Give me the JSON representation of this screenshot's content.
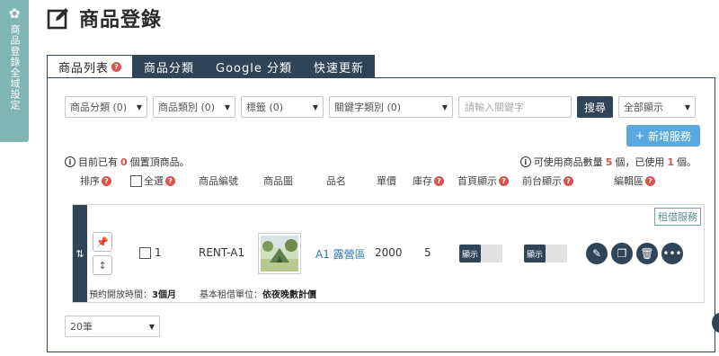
{
  "side_tab": {
    "label": "商品登錄全域設定",
    "icon": "gear-icon"
  },
  "page": {
    "title": "商品登錄",
    "icon": "edit-square-icon"
  },
  "tabs": [
    {
      "label": "商品列表",
      "active": true
    },
    {
      "label": "商品分類",
      "active": false
    },
    {
      "label": "Google 分類",
      "active": false
    },
    {
      "label": "快速更新",
      "active": false
    }
  ],
  "filters": {
    "product_category": "商品分類 (0)",
    "product_type": "商品類別 (0)",
    "tag": "標籤 (0)",
    "keyword_type": "關鍵字類別 (0)",
    "keyword_placeholder": "請輸入關鍵字",
    "search_button": "搜尋",
    "display": "全部顯示"
  },
  "add_button": "新增服務",
  "info": {
    "pinned_prefix": "目前已有",
    "pinned_count": "0",
    "pinned_suffix": "個置頂商品。",
    "quota_prefix": "可使用商品數量",
    "quota_total": "5",
    "quota_mid": "個，已使用",
    "quota_used": "1",
    "quota_suffix": "個。"
  },
  "columns": {
    "sort": "排序",
    "select_all": "全選",
    "code": "商品編號",
    "image": "商品圖",
    "name": "品名",
    "price": "單價",
    "stock": "庫存",
    "home_display": "首頁顯示",
    "front_display": "前台顯示",
    "edit": "編輯區"
  },
  "rows": [
    {
      "badge": "租借服務",
      "index": "1",
      "code": "RENT-A1",
      "name": "A1 露營區",
      "price": "2000",
      "stock": "5",
      "home_display": "顯示",
      "front_display": "顯示",
      "footer_open_label": "預約開放時間：",
      "footer_open_value": "3個月",
      "footer_unit_label": "基本租借單位：",
      "footer_unit_value": "依夜晚數計價"
    }
  ],
  "per_page": "20筆",
  "colors": {
    "navy": "#2f4457",
    "teal": "#7fb5b5",
    "accent": "#5aa8e0",
    "red": "#d9534f"
  }
}
